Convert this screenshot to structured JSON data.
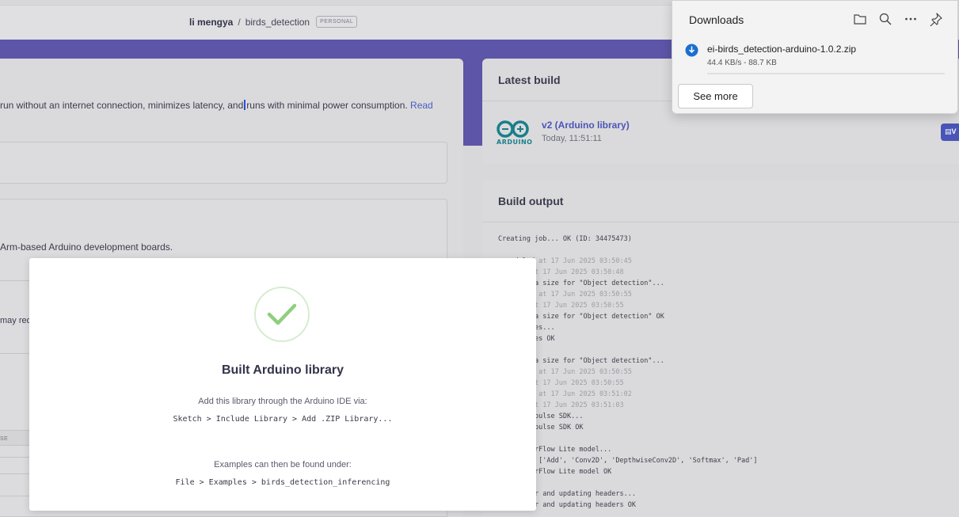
{
  "header": {
    "owner": "li mengya",
    "separator": "/",
    "project": "birds_detection",
    "badge": "PERSONAL"
  },
  "left": {
    "intro_text": "run without an internet connection, minimizes latency, and",
    "intro_text_after": "runs with minimal power consumption.",
    "intro_link": "Read",
    "arm_text": "Arm-based Arduino development boards.",
    "may_text": "may red",
    "column_fragment": "SE"
  },
  "latest_build": {
    "title": "Latest build",
    "logo_word": "ARDUINO",
    "name": "v2 (Arduino library)",
    "time": "Today, 11:51:11",
    "button_label": "V"
  },
  "build_output": {
    "title": "Build output",
    "lines": [
      {
        "text": "Creating job... OK (ID: 34475473)",
        "ts": ""
      },
      {
        "text": "",
        "ts": ""
      },
      {
        "text": "   eduled",
        "ts": " at 17 Jun 2025 03:50:45"
      },
      {
        "text": "   rted",
        "ts": " at 17 Jun 2025 03:50:48"
      },
      {
        "text": "   g arena size for \"Object detection\"...",
        "ts": ""
      },
      {
        "text": "   eduled",
        "ts": " at 17 Jun 2025 03:50:55"
      },
      {
        "text": "   rted",
        "ts": " at 17 Jun 2025 03:50:55"
      },
      {
        "text": "   g arena size for \"Object detection\" OK",
        "ts": ""
      },
      {
        "text": "   emplates...",
        "ts": ""
      },
      {
        "text": "   emplates OK",
        "ts": ""
      },
      {
        "text": "",
        "ts": ""
      },
      {
        "text": "   g arena size for \"Object detection\"...",
        "ts": ""
      },
      {
        "text": "   eduled",
        "ts": " at 17 Jun 2025 03:50:55"
      },
      {
        "text": "   rted",
        "ts": " at 17 Jun 2025 03:50:55"
      },
      {
        "text": "   eduled",
        "ts": " at 17 Jun 2025 03:51:02"
      },
      {
        "text": "   rted",
        "ts": " at 17 Jun 2025 03:51:03"
      },
      {
        "text": "   dge Impulse SDK...",
        "ts": ""
      },
      {
        "text": "   dge Impulse SDK OK",
        "ts": ""
      },
      {
        "text": "",
        "ts": ""
      },
      {
        "text": "    TensorFlow Lite model...",
        "ts": ""
      },
      {
        "text": "   rators ['Add', 'Conv2D', 'DepthwiseConv2D', 'Softmax', 'Pad']",
        "ts": ""
      },
      {
        "text": "    TensorFlow Lite model OK",
        "ts": ""
      },
      {
        "text": "",
        "ts": ""
      },
      {
        "text": "   clutter and updating headers...",
        "ts": ""
      },
      {
        "text": "   clutter and updating headers OK",
        "ts": ""
      }
    ]
  },
  "modal": {
    "title": "Built Arduino library",
    "line1": "Add this library through the Arduino IDE via:",
    "code1": "Sketch > Include Library > Add .ZIP Library...",
    "line2": "Examples can then be found under:",
    "code2": "File > Examples > birds_detection_inferencing",
    "success_color": "#8fcf7f"
  },
  "downloads": {
    "title": "Downloads",
    "icons": [
      "folder-icon",
      "search-icon",
      "more-icon",
      "pin-icon"
    ],
    "file_name": "ei-birds_detection-arduino-1.0.2.zip",
    "file_meta": "44.4 KB/s - 88.7 KB",
    "see_more": "See more"
  },
  "colors": {
    "banner": "#5d55a8",
    "link": "#4a55b8",
    "arduino_teal": "#1a7f8a"
  }
}
